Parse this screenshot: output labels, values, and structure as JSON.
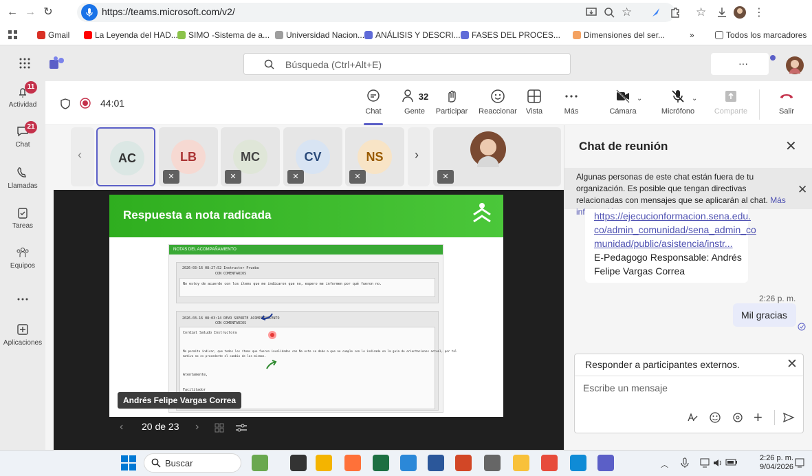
{
  "browser": {
    "url": "https://teams.microsoft.com/v2/",
    "bookmarks": [
      {
        "label": "Gmail",
        "color": "#d93025"
      },
      {
        "label": "La Leyenda del HAD...",
        "color": "#ff0000"
      },
      {
        "label": "SIMO -Sistema de a...",
        "color": "#8bc34a"
      },
      {
        "label": "Universidad Nacion...",
        "color": "#9e9e9e"
      },
      {
        "label": "ANÁLISIS Y DESCRI...",
        "color": "#5f6bd8"
      },
      {
        "label": "FASES DEL PROCES...",
        "color": "#5f6bd8"
      },
      {
        "label": "Dimensiones del ser...",
        "color": "#f4a261"
      }
    ],
    "bookmarks_more": "»",
    "all_bookmarks": "Todos los marcadores"
  },
  "teams": {
    "search_placeholder": "Búsqueda (Ctrl+Alt+E)",
    "more_label": "···"
  },
  "rail": [
    {
      "label": "Actividad",
      "icon": "bell-icon",
      "badge": "11"
    },
    {
      "label": "Chat",
      "icon": "chat-icon",
      "badge": "21"
    },
    {
      "label": "Llamadas",
      "icon": "phone-icon",
      "badge": ""
    },
    {
      "label": "Tareas",
      "icon": "tasks-icon",
      "badge": ""
    },
    {
      "label": "Equipos",
      "icon": "teams-icon",
      "badge": ""
    },
    {
      "label": "...",
      "icon": "more-icon",
      "badge": ""
    },
    {
      "label": "Aplicaciones",
      "icon": "add-apps-icon",
      "badge": ""
    }
  ],
  "meeting": {
    "timer": "44:01",
    "toolbar": [
      {
        "label": "Chat",
        "icon": "chat-icon"
      },
      {
        "label": "Gente",
        "icon": "people-icon",
        "count": "32"
      },
      {
        "label": "Participar",
        "icon": "raise-hand-icon"
      },
      {
        "label": "Reaccionar",
        "icon": "emoji-icon"
      },
      {
        "label": "Vista",
        "icon": "view-icon"
      },
      {
        "label": "Más",
        "icon": "more-icon"
      },
      {
        "label": "Cámara",
        "icon": "camera-off-icon"
      },
      {
        "label": "Micrófono",
        "icon": "mic-off-icon"
      },
      {
        "label": "Comparte",
        "icon": "share-icon"
      },
      {
        "label": "Salir",
        "icon": "hangup-icon"
      }
    ],
    "participants": [
      {
        "initials": "AC",
        "bg": "#dbe7e4",
        "fg": "#333",
        "active": true,
        "muted": false
      },
      {
        "initials": "LB",
        "bg": "#f6d9d2",
        "fg": "#a33",
        "active": false,
        "muted": true
      },
      {
        "initials": "MC",
        "bg": "#dfe6d8",
        "fg": "#444",
        "active": false,
        "muted": true
      },
      {
        "initials": "CV",
        "bg": "#d8e4f3",
        "fg": "#2a4a7a",
        "active": false,
        "muted": true
      },
      {
        "initials": "NS",
        "bg": "#f8e4c6",
        "fg": "#9a5b00",
        "active": false,
        "muted": true
      }
    ],
    "presenter_name": "Andrés Felipe Vargas Correa",
    "pager": "20 de 23"
  },
  "slide": {
    "title": "Respuesta a nota radicada",
    "logo_text": "SENA",
    "doc_header": "NOTAS DEL ACOMPAÑAMIENTO",
    "entry1_head": "2026-03-16 08:27:52   Instructor Prueba",
    "entry1_sub": "CON COMENTARIOS",
    "entry1_text": "No estoy de acuerdo con los ítems que me indicaron que no, espero me informen por qué fueron no.",
    "entry2_head": "2026-03-16 08:03:14   DEVO SOPORTE ACOMPAÑAMIENTO",
    "entry2_sub": "CON COMENTARIOS",
    "entry2_greet": "Cordial Saludo Instructora",
    "entry2_body1": "Me permito indicar, que todos los ítems que fueron invalidados con No esto se debe a que no cumple con lo indicado en la guía de orientaciones actual, por tal",
    "entry2_body2": "motivo no es procedente el cambio de los mismos.",
    "entry2_close": "Atentamente,",
    "entry2_sign": "Facilitador"
  },
  "chat": {
    "title": "Chat de reunión",
    "notice": "Algunas personas de este chat están fuera de tu organización. Es posible que tengan directivas relacionadas con mensajes que se aplicarán al chat.",
    "notice_link": "Más información",
    "msg_link_lines": [
      "https://ejecucionformacion.sena.edu.",
      "co/admin_comunidad/sena_admin_co",
      "munidad/public/asistencia/instr..."
    ],
    "msg_lines": [
      "E-Pedagogo Responsable: Andrés",
      "Felipe Vargas Correa"
    ],
    "my_time": "2:26 p. m.",
    "my_message": "Mil gracias",
    "compose_header": "Responder a participantes externos.",
    "compose_placeholder": "Escribe un mensaje"
  },
  "taskbar": {
    "search": "Buscar",
    "time": "2:26 p. m.",
    "date": "9/04/2026"
  }
}
